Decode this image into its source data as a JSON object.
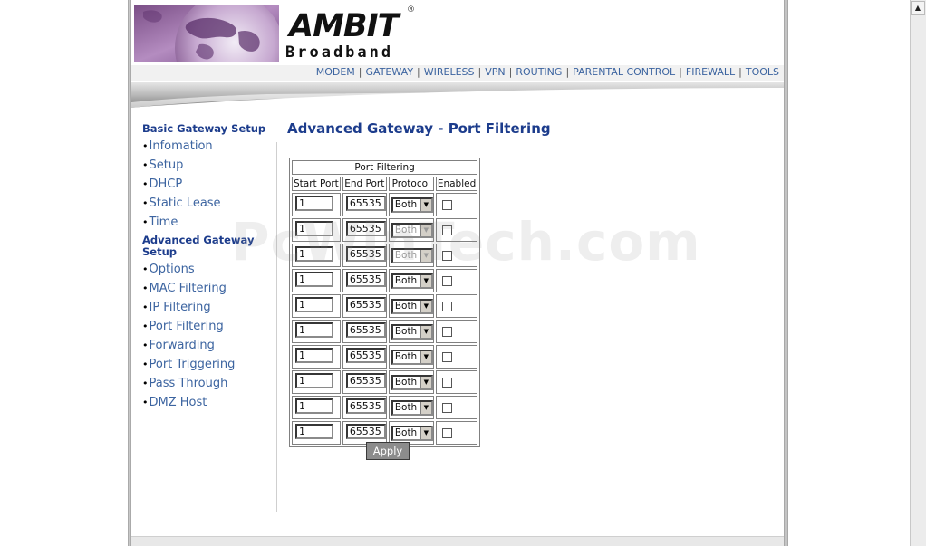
{
  "brand": {
    "name": "AMBIT",
    "registered": "®",
    "sub": "Broadband"
  },
  "topnav": [
    "MODEM",
    "GATEWAY",
    "WIRELESS",
    "VPN",
    "ROUTING",
    "PARENTAL CONTROL",
    "FIREWALL",
    "TOOLS"
  ],
  "sidebar": {
    "basic_heading": "Basic Gateway Setup",
    "basic_items": [
      "Infomation",
      "Setup",
      "DHCP",
      "Static Lease",
      "Time"
    ],
    "advanced_heading_line1": "Advanced Gateway",
    "advanced_heading_line2": "Setup",
    "advanced_items": [
      "Options",
      "MAC Filtering",
      "IP Filtering",
      "Port Filtering",
      "Forwarding",
      "Port Triggering",
      "Pass Through",
      "DMZ Host"
    ]
  },
  "main": {
    "title": "Advanced Gateway - Port Filtering",
    "table_caption": "Port Filtering",
    "columns": [
      "Start Port",
      "End Port",
      "Protocol",
      "Enabled"
    ],
    "rows": [
      {
        "start": "1",
        "end": "65535",
        "protocol": "Both",
        "enabled": false
      },
      {
        "start": "1",
        "end": "65535",
        "protocol": "Both",
        "enabled": false
      },
      {
        "start": "1",
        "end": "65535",
        "protocol": "Both",
        "enabled": false
      },
      {
        "start": "1",
        "end": "65535",
        "protocol": "Both",
        "enabled": false
      },
      {
        "start": "1",
        "end": "65535",
        "protocol": "Both",
        "enabled": false
      },
      {
        "start": "1",
        "end": "65535",
        "protocol": "Both",
        "enabled": false
      },
      {
        "start": "1",
        "end": "65535",
        "protocol": "Both",
        "enabled": false
      },
      {
        "start": "1",
        "end": "65535",
        "protocol": "Both",
        "enabled": false
      },
      {
        "start": "1",
        "end": "65535",
        "protocol": "Both",
        "enabled": false
      },
      {
        "start": "1",
        "end": "65535",
        "protocol": "Both",
        "enabled": false
      }
    ],
    "apply_label": "Apply"
  },
  "watermark": "PcWinTech.com",
  "colors": {
    "heading": "#1c3c8c",
    "link": "#3c64a0",
    "button": "#8c8c8c"
  }
}
